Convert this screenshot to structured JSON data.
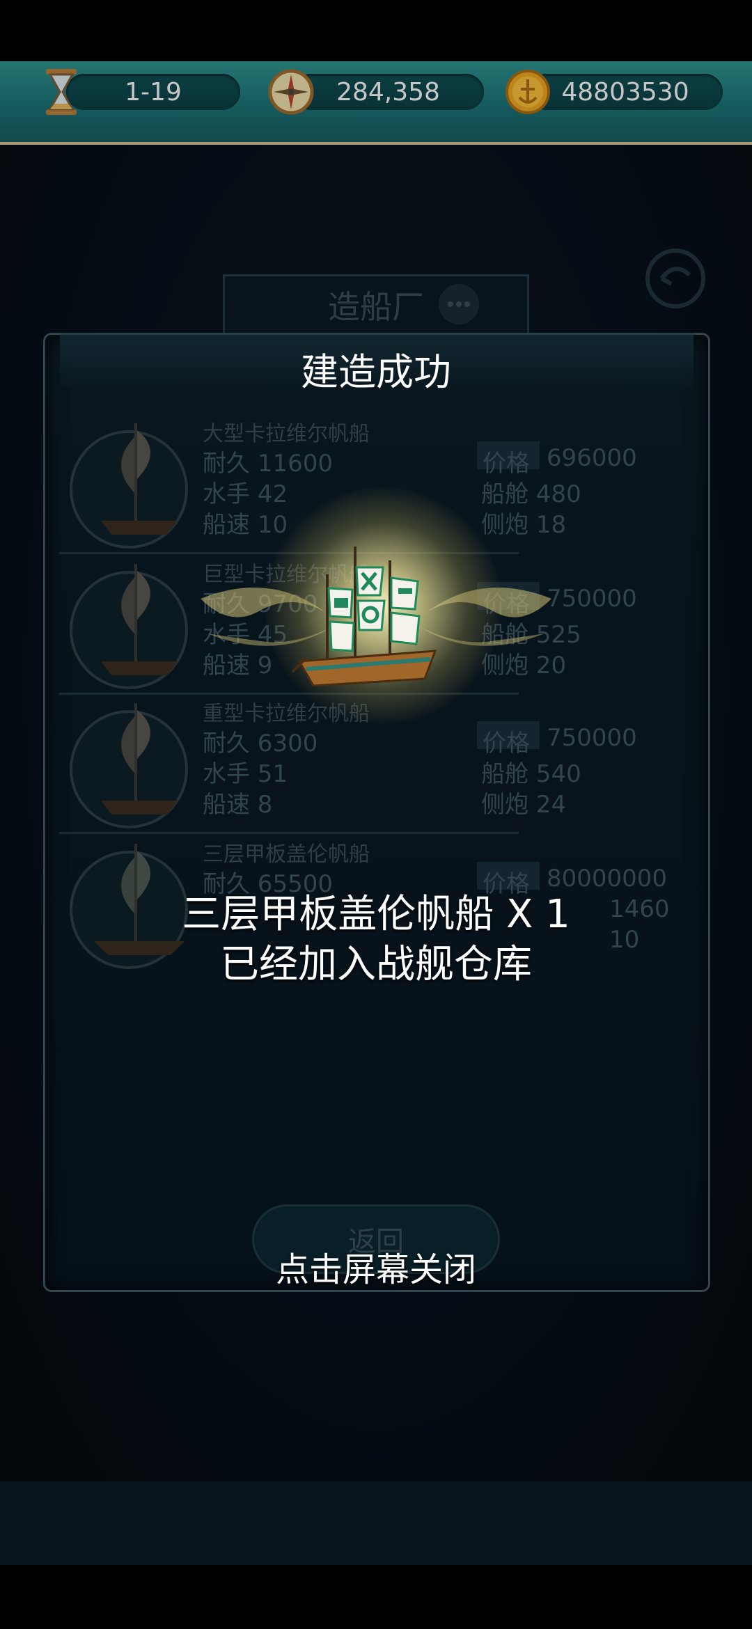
{
  "topbar": {
    "stage": "1-19",
    "compass_value": "284,358",
    "gold": "48803530",
    "icons": [
      "hourglass-icon",
      "compass-icon",
      "gold-coin-icon"
    ]
  },
  "shipyard": {
    "title": "造船厂",
    "ships": [
      {
        "name": "大型卡拉维尔帆船",
        "durability": "耐久 11600",
        "sailors": "水手 42",
        "speed": "船速 10",
        "price_label": "价格",
        "price": "696000",
        "cabin": "船舱 480",
        "cannons": "侧炮 18"
      },
      {
        "name": "巨型卡拉维尔帆船",
        "durability": "耐久 9700",
        "sailors": "水手 45",
        "speed": "船速 9",
        "price_label": "价格",
        "price": "750000",
        "cabin": "船舱 525",
        "cannons": "侧炮 20"
      },
      {
        "name": "重型卡拉维尔帆船",
        "durability": "耐久 6300",
        "sailors": "水手 51",
        "speed": "船速 8",
        "price_label": "价格",
        "price": "750000",
        "cabin": "船舱 540",
        "cannons": "侧炮 24"
      },
      {
        "name": "三层甲板盖伦帆船",
        "durability": "耐久 65500",
        "sailors": "",
        "speed": "",
        "price_label": "价格",
        "price": "80000000",
        "cabin": "1460",
        "cannons": "10"
      }
    ],
    "return_label": "返回"
  },
  "dialog": {
    "title": "建造成功",
    "line1": "三层甲板盖伦帆船 X 1",
    "line2": "已经加入战舰仓库",
    "tap_close": "点击屏幕关闭"
  },
  "colors": {
    "topbar_teal": "#1b6f72",
    "panel_dark": "#081520",
    "glow": "#f5eeb0"
  }
}
